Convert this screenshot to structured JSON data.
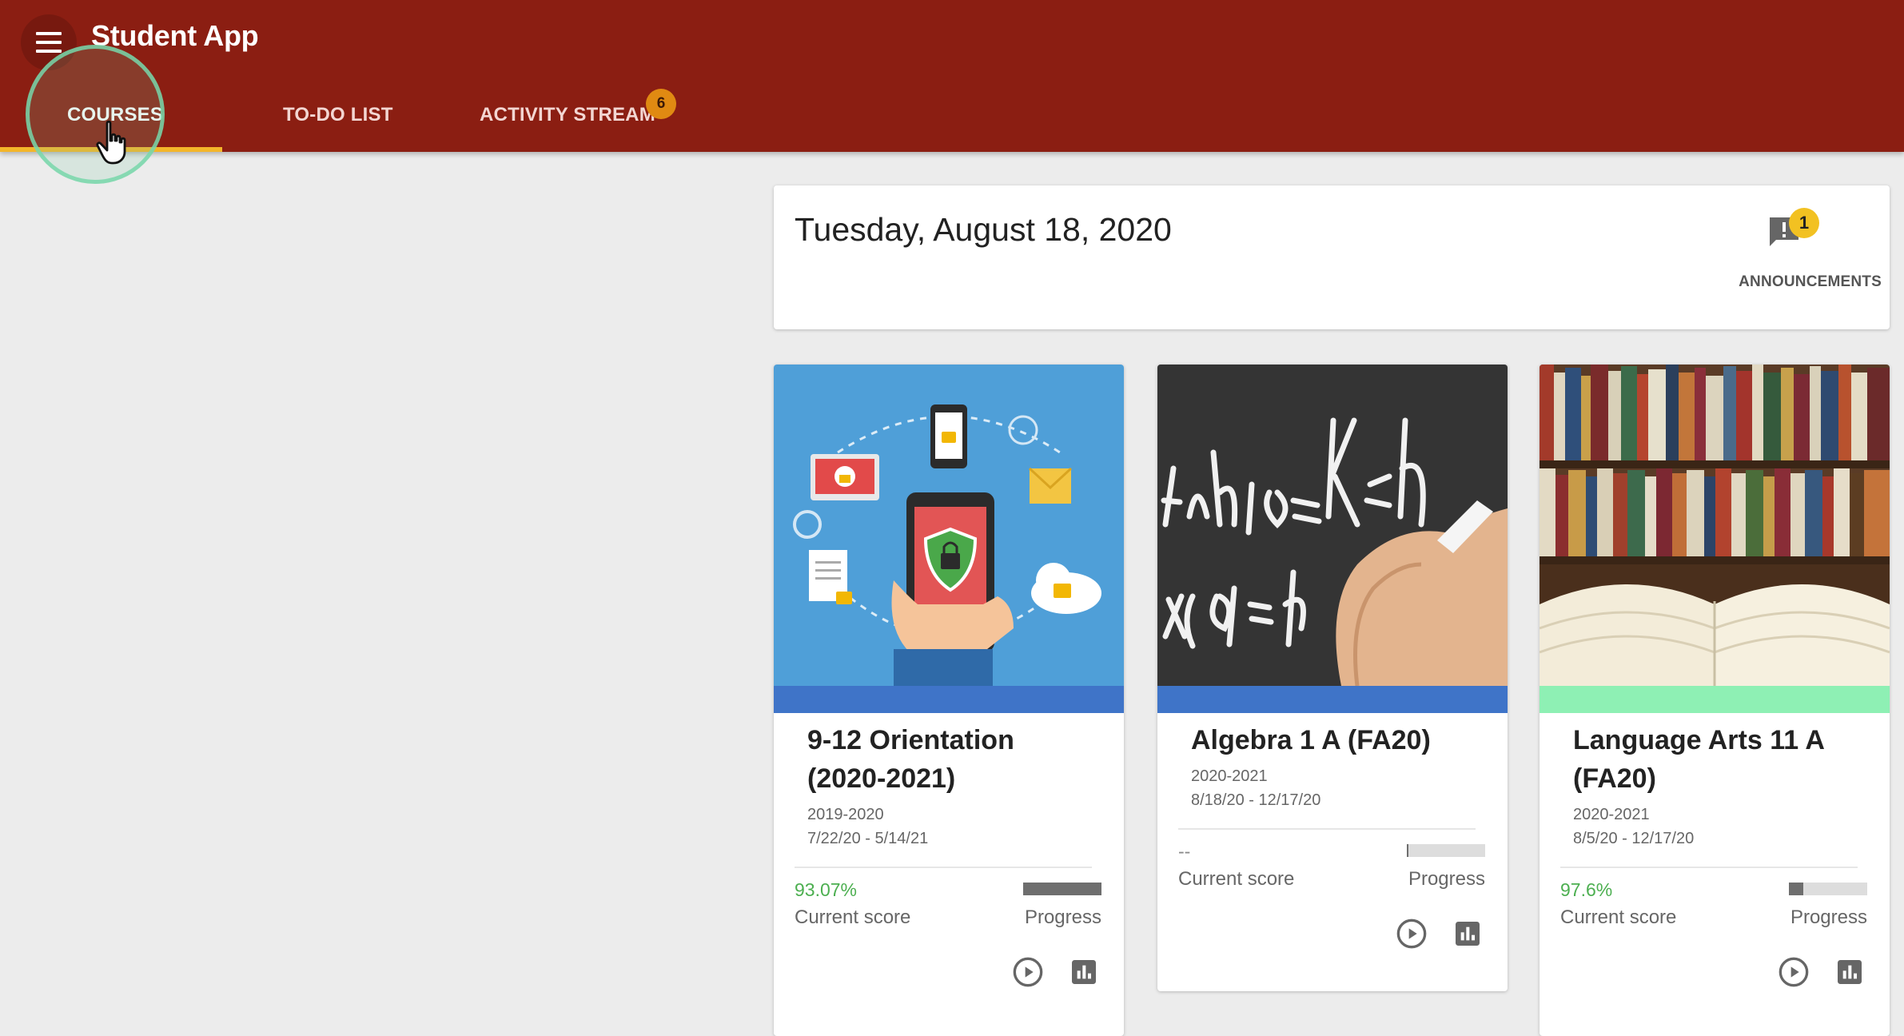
{
  "app": {
    "title": "Student App",
    "menu_icon": "hamburger-menu-icon",
    "brand_color": "#8b1e12",
    "accent_color": "#f3b52a"
  },
  "tabs": [
    {
      "label": "COURSES",
      "active": true
    },
    {
      "label": "TO-DO LIST",
      "active": false
    },
    {
      "label": "ACTIVITY STREAM",
      "active": false,
      "badge": "6"
    }
  ],
  "header_card": {
    "date": "Tuesday, August 18, 2020",
    "announcements_label": "ANNOUNCEMENTS",
    "announcements_count": "1",
    "announcements_icon": "announcement-icon"
  },
  "courses": [
    {
      "name": "9-12 Orientation (2020-2021)",
      "year": "2019-2020",
      "dates": "7/22/20 - 5/14/21",
      "score": "93.07%",
      "score_label": "Current score",
      "progress_label": "Progress",
      "progress": 1.0,
      "strip_color": "#3f74c8",
      "image": "mobile-security-illustration"
    },
    {
      "name": "Algebra 1 A (FA20)",
      "year": "2020-2021",
      "dates": "8/18/20 - 12/17/20",
      "score": "--",
      "score_label": "Current score",
      "progress_label": "Progress",
      "progress": 0.02,
      "strip_color": "#3f74c8",
      "image": "chalkboard-math-photo"
    },
    {
      "name": "Language Arts 11 A (FA20)",
      "year": "2020-2021",
      "dates": "8/5/20 - 12/17/20",
      "score": "97.6%",
      "score_label": "Current score",
      "progress_label": "Progress",
      "progress": 0.18,
      "strip_color": "#8ef0b4",
      "image": "open-book-library-photo"
    }
  ]
}
